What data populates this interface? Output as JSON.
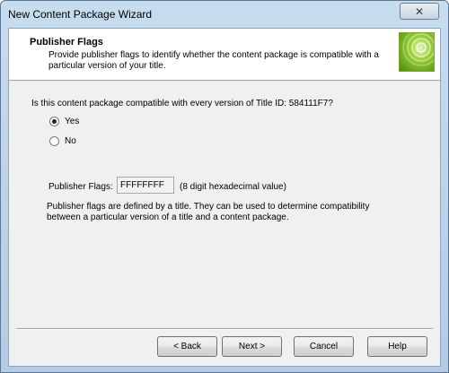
{
  "window": {
    "title": "New Content Package Wizard",
    "close_glyph": "✕"
  },
  "header": {
    "title": "Publisher Flags",
    "description": "Provide publisher flags to identify whether the content package is compatible with a particular version of your title.",
    "logo_icon": "wizard-logo-icon",
    "logo_color": "#7cbf1e"
  },
  "content": {
    "question": "Is this content package compatible with every version of Title ID: 584111F7?",
    "options": [
      {
        "label": "Yes",
        "selected": true
      },
      {
        "label": "No",
        "selected": false
      }
    ],
    "flags_label": "Publisher Flags:",
    "flags_value": "FFFFFFFF",
    "flags_hint": "(8 digit hexadecimal value)",
    "flags_description": "Publisher flags are defined by a title.  They can be used to determine compatibility between a particular version of a title and a content package."
  },
  "buttons": {
    "back": "< Back",
    "next": "Next >",
    "cancel": "Cancel",
    "help": "Help"
  }
}
